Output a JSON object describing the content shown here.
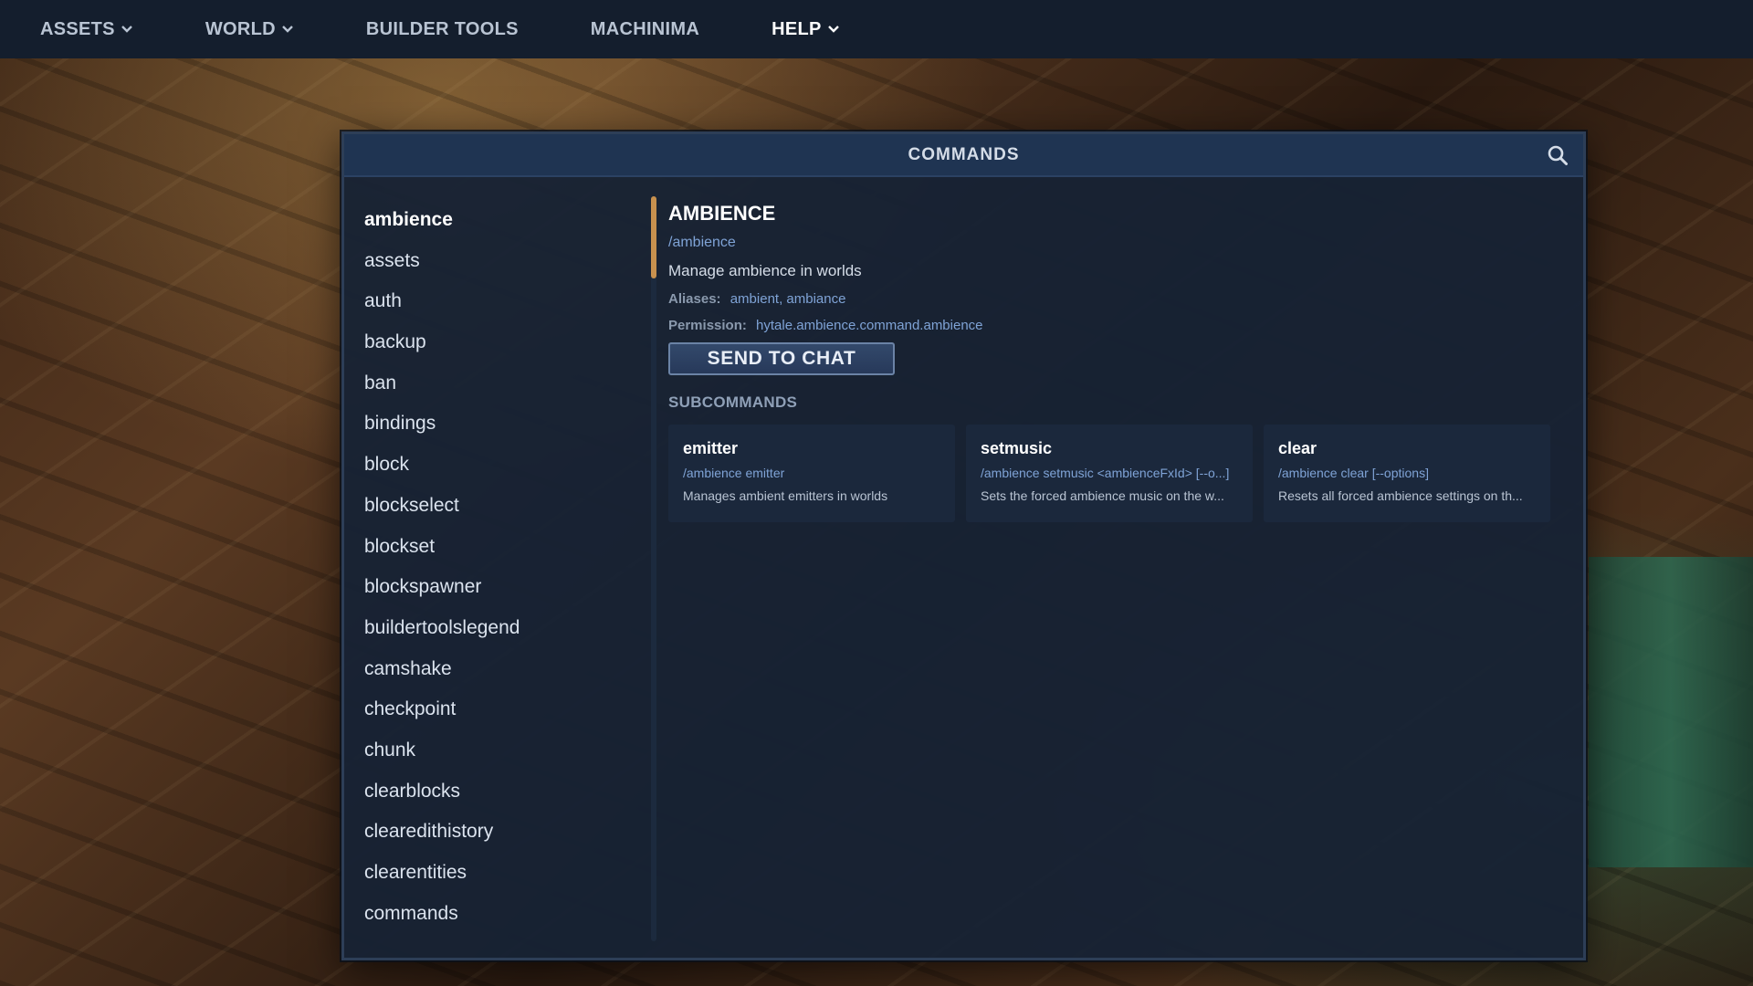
{
  "topnav": {
    "items": [
      {
        "label": "ASSETS",
        "has_dropdown": true
      },
      {
        "label": "WORLD",
        "has_dropdown": true
      },
      {
        "label": "BUILDER TOOLS",
        "has_dropdown": false
      },
      {
        "label": "MACHINIMA",
        "has_dropdown": false
      },
      {
        "label": "HELP",
        "has_dropdown": true
      }
    ],
    "active": "HELP"
  },
  "panel": {
    "title": "COMMANDS",
    "search_icon": "search-icon"
  },
  "commands": [
    "ambience",
    "assets",
    "auth",
    "backup",
    "ban",
    "bindings",
    "block",
    "blockselect",
    "blockset",
    "blockspawner",
    "buildertoolslegend",
    "camshake",
    "checkpoint",
    "chunk",
    "clearblocks",
    "clearedithistory",
    "clearentities",
    "commands"
  ],
  "selected_command": "ambience",
  "detail": {
    "title": "AMBIENCE",
    "usage": "/ambience",
    "description": "Manage ambience in worlds",
    "aliases_label": "Aliases:",
    "aliases_value": "ambient, ambiance",
    "permission_label": "Permission:",
    "permission_value": "hytale.ambience.command.ambience",
    "send_button": "SEND TO CHAT",
    "subcommands_heading": "SUBCOMMANDS",
    "subcommands": [
      {
        "name": "emitter",
        "usage": "/ambience emitter",
        "description": "Manages ambient emitters in worlds"
      },
      {
        "name": "setmusic",
        "usage": "/ambience setmusic <ambienceFxId> [--o...]",
        "description": "Sets the forced ambience music on the w..."
      },
      {
        "name": "clear",
        "usage": "/ambience clear [--options]",
        "description": "Resets all forced ambience settings on th..."
      }
    ]
  },
  "colors": {
    "accent_scroll": "#c8914e",
    "link_blue": "#7fa3d6",
    "panel_bg": "#172234",
    "header_bg": "#1f3452"
  }
}
